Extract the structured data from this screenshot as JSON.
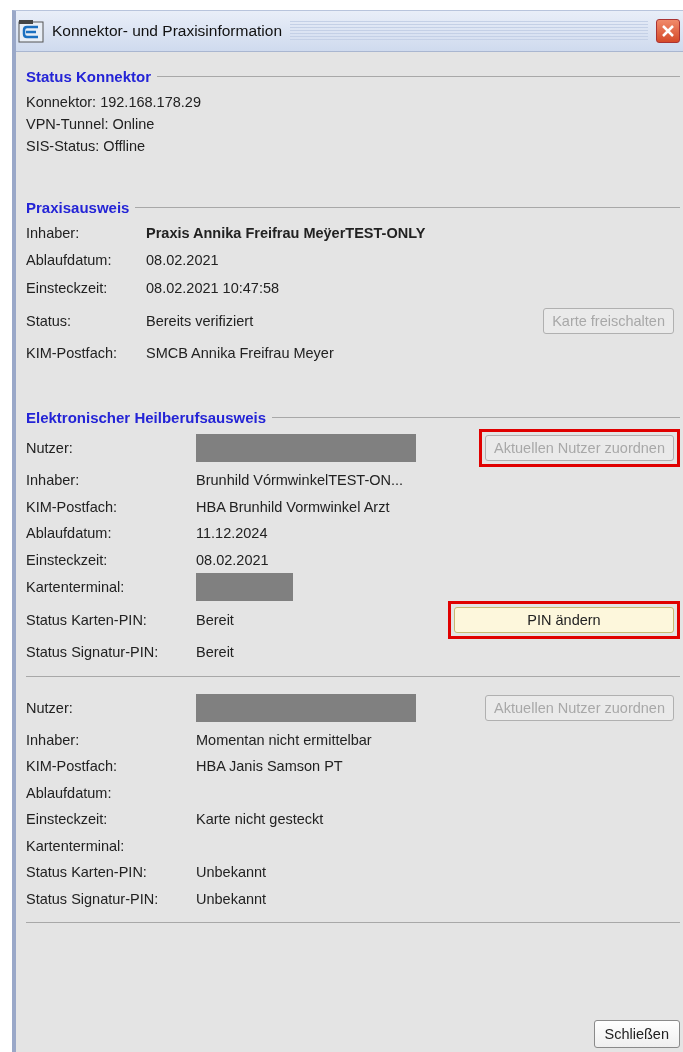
{
  "window": {
    "title": "Konnektor- und Praxisinformation"
  },
  "sections": [
    {
      "kind": "lines",
      "title": "Status Konnektor",
      "lines": [
        "Konnektor: 192.168.178.29",
        "VPN-Tunnel: Online",
        "SIS-Status: Offline"
      ]
    },
    {
      "kind": "fields",
      "title": "Praxisausweis",
      "rows": [
        {
          "label": "Inhaber:",
          "value": "Praxis Annika Freifrau MeÿerTEST-ONLY",
          "bold": true
        },
        {
          "label": "Ablaufdatum:",
          "value": "08.02.2021"
        },
        {
          "label": "Einsteckzeit:",
          "value": "08.02.2021 10:47:58"
        },
        {
          "label": "Status:",
          "value": "Bereits verifiziert",
          "button": {
            "label": "Karte freischalten",
            "disabled": true,
            "highlighted": false
          }
        },
        {
          "label": "KIM-Postfach:",
          "value": "SMCB Annika Freifrau Meyer"
        }
      ]
    },
    {
      "kind": "cards",
      "title": "Elektronischer Heilberufsausweis",
      "cards": [
        {
          "rows": [
            {
              "label": "Nutzer:",
              "redacted": true,
              "button": {
                "label": "Aktuellen Nutzer zuordnen",
                "disabled": true,
                "highlighted": true
              }
            },
            {
              "label": "Inhaber:",
              "value": "Brunhild VórmwinkelTEST-ON..."
            },
            {
              "label": "KIM-Postfach:",
              "value": "HBA Brunhild Vormwinkel Arzt"
            },
            {
              "label": "Ablaufdatum:",
              "value": "11.12.2024"
            },
            {
              "label": "Einsteckzeit:",
              "value": "08.02.2021"
            },
            {
              "label": "Kartenterminal:",
              "redacted": true
            },
            {
              "label": "Status Karten-PIN:",
              "value": "Bereit",
              "button": {
                "label": "PIN ändern",
                "disabled": false,
                "highlighted": true
              }
            },
            {
              "label": "Status Signatur-PIN:",
              "value": "Bereit"
            }
          ]
        },
        {
          "rows": [
            {
              "label": "Nutzer:",
              "redacted": true,
              "button": {
                "label": "Aktuellen Nutzer zuordnen",
                "disabled": true,
                "highlighted": false
              }
            },
            {
              "label": "Inhaber:",
              "value": "Momentan nicht ermittelbar"
            },
            {
              "label": "KIM-Postfach:",
              "value": "HBA Janis Samson PT"
            },
            {
              "label": "Ablaufdatum:"
            },
            {
              "label": "Einsteckzeit:",
              "value": "Karte nicht gesteckt"
            },
            {
              "label": "Kartenterminal:"
            },
            {
              "label": "Status Karten-PIN:",
              "value": "Unbekannt"
            },
            {
              "label": "Status Signatur-PIN:",
              "value": "Unbekannt"
            }
          ]
        }
      ]
    }
  ],
  "footer": {
    "button": "Schließen"
  }
}
